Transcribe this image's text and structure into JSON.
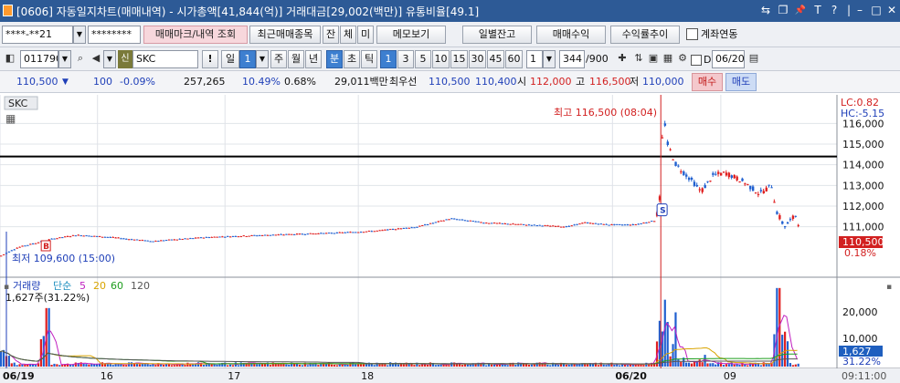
{
  "window": {
    "title": "[0606] 자동일지차트(매매내역) - 시가총액[41,844(억)] 거래대금[29,002(백만)] 유통비율[49.1]",
    "controls": [
      "⇆",
      "❐",
      "📌",
      "T",
      "?",
      "|",
      "–",
      "□",
      "✕"
    ]
  },
  "toolbar1": {
    "account": "****-**21",
    "password": "********",
    "btn_trade_mark": "매매마크/내역 조회",
    "btn_recent": "최근매매종목",
    "btn_jan": "잔",
    "btn_che": "체",
    "btn_mi": "미",
    "btn_memo": "메모보기",
    "btn_daily": "일별잔고",
    "btn_profit": "매매수익",
    "btn_return": "수익률추이",
    "chk_linked": "계좌연동"
  },
  "toolbar2": {
    "code": "011790",
    "badge": "신",
    "name": "SKC",
    "period_il": "일",
    "period_il_num": "1",
    "periods": [
      "주",
      "월",
      "년"
    ],
    "unit_bun": "분",
    "unit_cho": "초",
    "unit_tick": "틱",
    "minute_options": [
      "1",
      "3",
      "5",
      "10",
      "15",
      "30",
      "45",
      "60"
    ],
    "minute_selected": "1",
    "count_value": "1",
    "count_display": "344",
    "count_total": "/900",
    "date": "06/20"
  },
  "quote": {
    "price": "110,500",
    "arrow": "▼",
    "change": "100",
    "change_pct": "-0.09%",
    "volume": "257,265",
    "turnover_pct": "10.49%",
    "vol_ratio": "0.68%",
    "amount": "29,011백만",
    "best_label": "최우선",
    "best_ask": "110,500",
    "best_bid": "110,400",
    "open_label": "시",
    "open": "112,000",
    "high_label": "고",
    "high": "116,500",
    "low_label": "저",
    "low": "110,000",
    "btn_buy": "매수",
    "btn_sell": "매도"
  },
  "chart_data": {
    "type": "candlestick",
    "symbol": "SKC",
    "price_axis": {
      "ticks": [
        "116,000",
        "115,000",
        "114,000",
        "113,000",
        "112,000",
        "111,000"
      ],
      "ylim": [
        109000,
        116500
      ]
    },
    "lc_label": "LC:0.82",
    "hc_label": "HC:-5.15",
    "current_price": "110,500",
    "current_pct": "0.18%",
    "high_annotation": "최고 116,500 (08:04)",
    "low_annotation": "최저 109,600 (15:00)",
    "horizontal_line": 114400,
    "markers": [
      {
        "label": "B",
        "type": "buy"
      },
      {
        "label": "S",
        "type": "sell"
      }
    ],
    "price_path": [
      [
        0,
        109600
      ],
      [
        0.02,
        110000
      ],
      [
        0.06,
        110400
      ],
      [
        0.09,
        110600
      ],
      [
        0.13,
        110500
      ],
      [
        0.18,
        110300
      ],
      [
        0.25,
        110500
      ],
      [
        0.32,
        110600
      ],
      [
        0.4,
        110700
      ],
      [
        0.45,
        110800
      ],
      [
        0.5,
        111000
      ],
      [
        0.54,
        111400
      ],
      [
        0.58,
        111200
      ],
      [
        0.63,
        111100
      ],
      [
        0.68,
        111000
      ],
      [
        0.7,
        111200
      ],
      [
        0.73,
        111100
      ],
      [
        0.76,
        111100
      ],
      [
        0.785,
        111300
      ],
      [
        0.79,
        112000
      ],
      [
        0.795,
        116500
      ],
      [
        0.8,
        115000
      ],
      [
        0.81,
        114000
      ],
      [
        0.83,
        113200
      ],
      [
        0.84,
        112700
      ],
      [
        0.855,
        113500
      ],
      [
        0.87,
        113600
      ],
      [
        0.89,
        113200
      ],
      [
        0.91,
        112600
      ],
      [
        0.925,
        113000
      ],
      [
        0.93,
        111800
      ],
      [
        0.94,
        111000
      ],
      [
        0.955,
        111600
      ],
      [
        0.96,
        110500
      ]
    ],
    "volume_panel": {
      "title": "거래량",
      "ma_label": "단순",
      "ma_periods": [
        "5",
        "20",
        "60",
        "120"
      ],
      "ma_colors": [
        "#c01fc0",
        "#d9a400",
        "#1e9d1e",
        "#555555"
      ],
      "current_volume": "1,627주(31.22%)",
      "axis_ticks": [
        "20,000",
        "10,000"
      ],
      "current_tag": "1,627",
      "current_pct": "31.22%"
    },
    "x_axis_labels": [
      "06/19",
      "16",
      "17",
      "18",
      "06/20",
      "09"
    ],
    "clock": "09:11:00"
  }
}
